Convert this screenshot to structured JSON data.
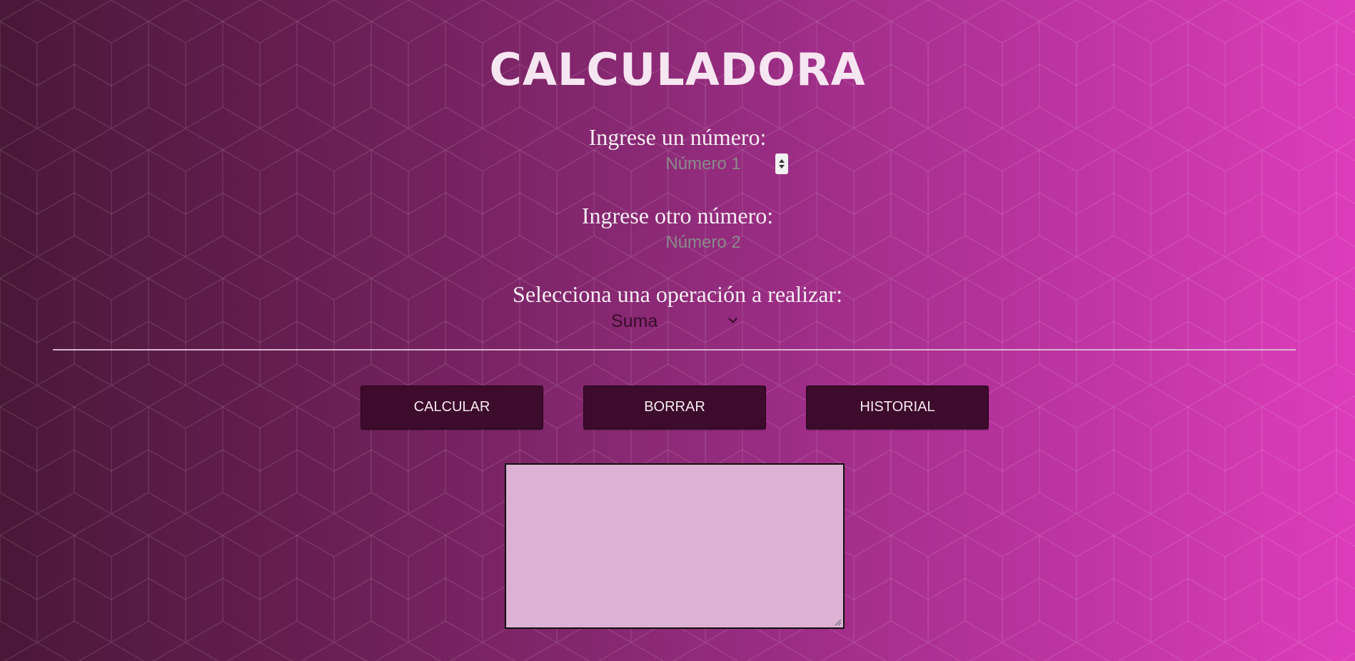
{
  "page": {
    "title": "CALCULADORA"
  },
  "form": {
    "first_label": "Ingrese un número:",
    "first_placeholder": "Número 1",
    "first_value": "",
    "second_label": "Ingrese otro número:",
    "second_placeholder": "Número 2",
    "second_value": "",
    "operation_label": "Selecciona una operación a realizar:",
    "operation_selected": "Suma"
  },
  "buttons": {
    "calculate": "CALCULAR",
    "clear": "BORRAR",
    "history": "HISTORIAL"
  },
  "output": {
    "value": ""
  },
  "colors": {
    "gradient_start": "#4a1838",
    "gradient_end": "#dd3dbb",
    "button_bg": "#3d0b2b",
    "output_bg": "#ddb1d3",
    "title_text": "#f6e6f1"
  },
  "icons": {
    "spinner": "number-spinner-icon",
    "select_arrow": "chevron-down-icon",
    "resize": "resize-grip-icon"
  }
}
